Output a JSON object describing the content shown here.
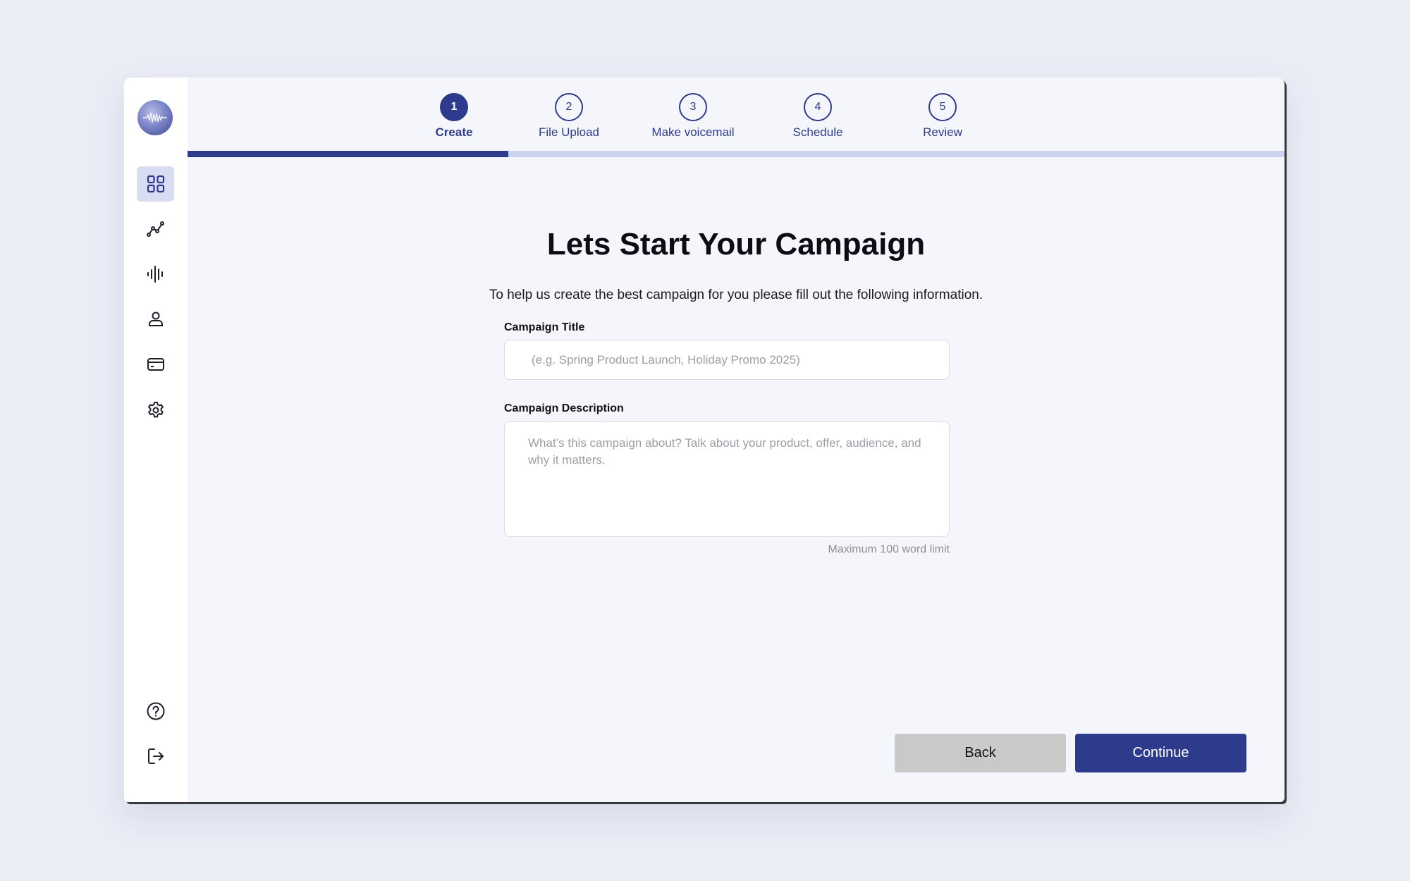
{
  "stepper": {
    "steps": [
      {
        "number": "1",
        "label": "Create",
        "active": true
      },
      {
        "number": "2",
        "label": "File Upload",
        "active": false
      },
      {
        "number": "3",
        "label": "Make voicemail",
        "active": false
      },
      {
        "number": "4",
        "label": "Schedule",
        "active": false
      },
      {
        "number": "5",
        "label": "Review",
        "active": false
      }
    ],
    "progress_fraction": 0.2925
  },
  "sidebar": {
    "top_items": [
      {
        "name": "dashboard-grid-icon",
        "active": true
      },
      {
        "name": "analytics-chart-icon",
        "active": false
      },
      {
        "name": "audio-waveform-icon",
        "active": false
      },
      {
        "name": "user-icon",
        "active": false
      },
      {
        "name": "credit-card-icon",
        "active": false
      },
      {
        "name": "gear-icon",
        "active": false
      }
    ],
    "bottom_items": [
      {
        "name": "help-icon"
      },
      {
        "name": "logout-icon"
      }
    ]
  },
  "form": {
    "heading": "Lets Start Your Campaign",
    "subtitle": "To help us create the best campaign for you please fill out the following information.",
    "title_label": "Campaign Title",
    "title_placeholder": "(e.g. Spring Product Launch, Holiday Promo 2025)",
    "title_value": "",
    "description_label": "Campaign Description",
    "description_placeholder": "What’s this campaign about? Talk about your product, offer, audience, and why it matters.",
    "description_value": "",
    "hint": "Maximum 100 word limit"
  },
  "actions": {
    "back_label": "Back",
    "continue_label": "Continue"
  },
  "colors": {
    "accent": "#2e3a8c",
    "progress_track": "#cdd3ef",
    "active_nav_bg": "#d9ddf3",
    "back_button_bg": "#c9c9ca",
    "page_bg": "#eaecf6"
  }
}
